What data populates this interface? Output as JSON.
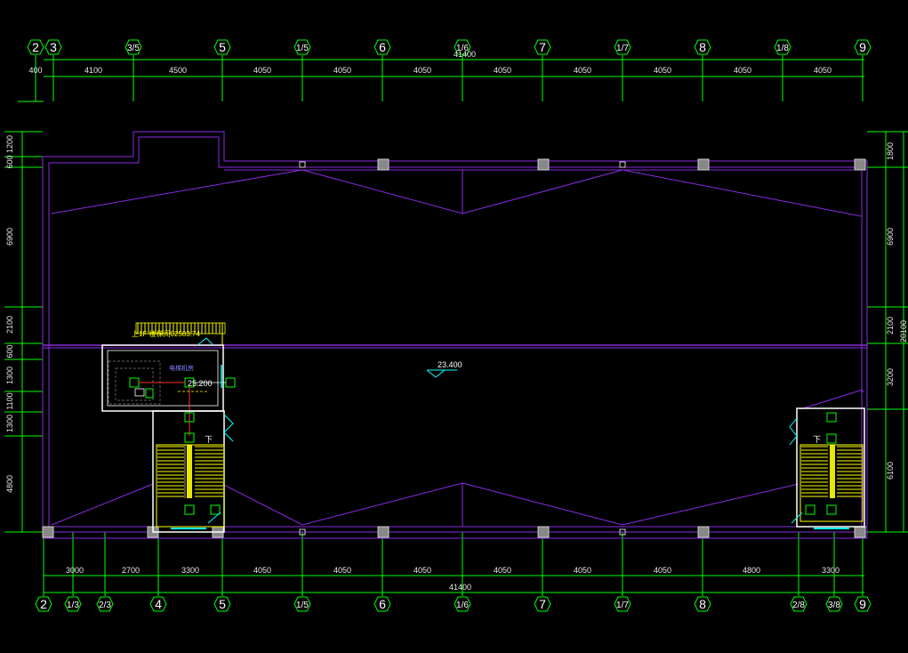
{
  "drawing": {
    "colors": {
      "background": "#000000",
      "dimension_line": "#00ff00",
      "wall": "#8a2be2",
      "stair": "#ffff00",
      "column": "#808080",
      "annotation": "#00ffff",
      "pipe": "#ff3030"
    },
    "top_axes": [
      "2",
      "3",
      "3/5",
      "5",
      "1/5",
      "6",
      "1/6",
      "7",
      "1/7",
      "8",
      "1/8",
      "9"
    ],
    "top_dimensions": [
      "400",
      "4100",
      "4500",
      "4050",
      "4050",
      "4050",
      "4050",
      "4050",
      "4050",
      "4050",
      "4050"
    ],
    "top_total": "41400",
    "bottom_axes": [
      "2",
      "1/3",
      "2/3",
      "4",
      "5",
      "1/5",
      "6",
      "1/6",
      "7",
      "1/7",
      "8",
      "2/8",
      "3/8",
      "9"
    ],
    "bottom_dimensions": [
      "3000",
      "2700",
      "3300",
      "4050",
      "4050",
      "4050",
      "4050",
      "4050",
      "4050",
      "4800",
      "3300"
    ],
    "bottom_total": "41400",
    "left_dimensions": [
      "1200",
      "600",
      "6900",
      "2100",
      "600",
      "1300",
      "1100",
      "1300",
      "4800"
    ],
    "right_dimensions": [
      "1800",
      "6900",
      "2100",
      "3200",
      "6100"
    ],
    "right_total": "20100",
    "elevation": "23.400",
    "stair_note": "上1F 楼梯间02503.74",
    "room_label": "电梯机房",
    "sub_elevation": "25.200",
    "stair_marker": "下"
  }
}
